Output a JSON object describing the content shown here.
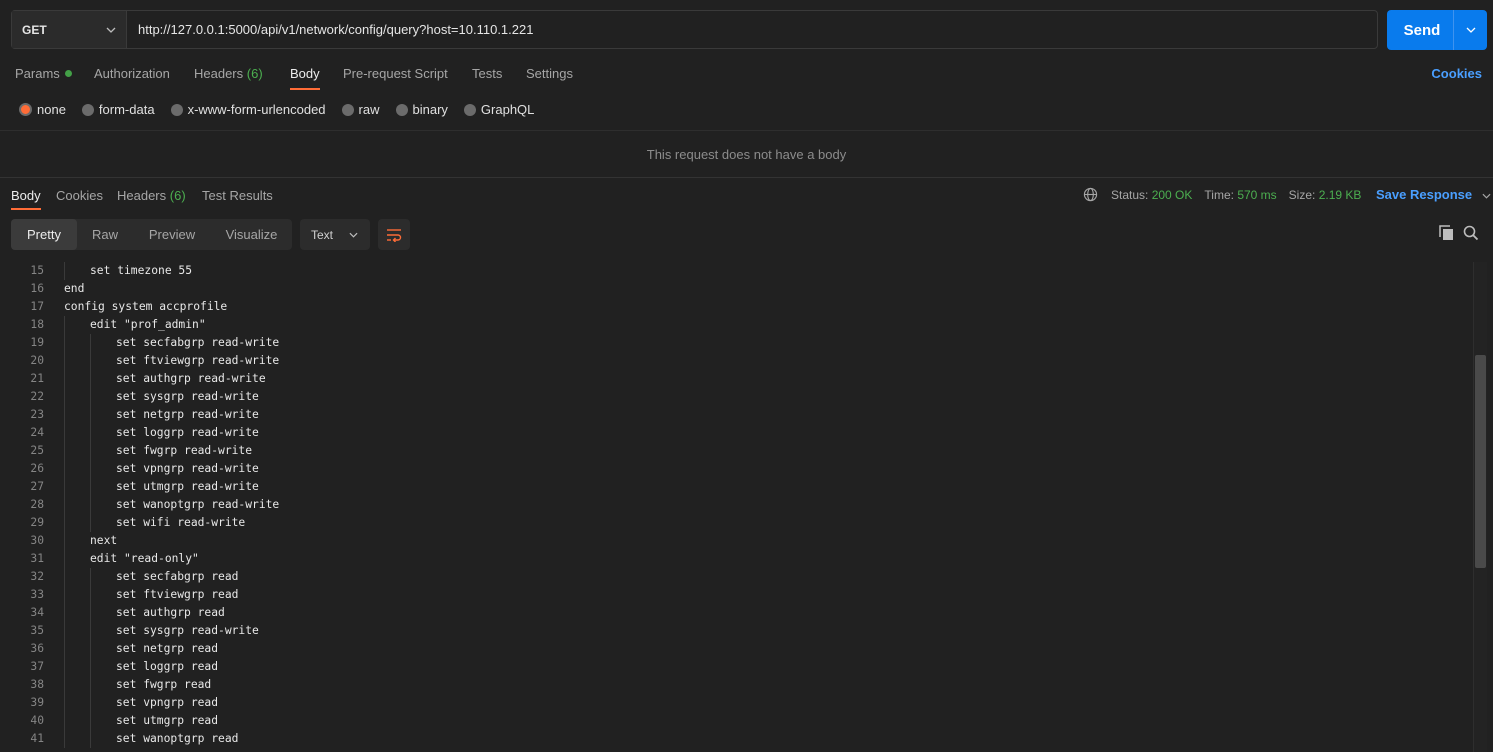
{
  "request": {
    "method": "GET",
    "url": "http://127.0.0.1:5000/api/v1/network/config/query?host=10.110.1.221",
    "send_label": "Send"
  },
  "request_tabs": [
    {
      "label": "Params",
      "count": null,
      "dot": true,
      "active": false
    },
    {
      "label": "Authorization",
      "count": null,
      "active": false
    },
    {
      "label": "Headers",
      "count": "(6)",
      "active": false
    },
    {
      "label": "Body",
      "count": null,
      "active": true
    },
    {
      "label": "Pre-request Script",
      "count": null,
      "active": false
    },
    {
      "label": "Tests",
      "count": null,
      "active": false
    },
    {
      "label": "Settings",
      "count": null,
      "active": false
    }
  ],
  "cookies_link": "Cookies",
  "body_types": [
    {
      "label": "none",
      "checked": true
    },
    {
      "label": "form-data",
      "checked": false
    },
    {
      "label": "x-www-form-urlencoded",
      "checked": false
    },
    {
      "label": "raw",
      "checked": false
    },
    {
      "label": "binary",
      "checked": false
    },
    {
      "label": "GraphQL",
      "checked": false
    }
  ],
  "no_body_message": "This request does not have a body",
  "response_tabs": [
    {
      "label": "Body",
      "count": null,
      "active": true
    },
    {
      "label": "Cookies",
      "count": null,
      "active": false
    },
    {
      "label": "Headers",
      "count": "(6)",
      "active": false
    },
    {
      "label": "Test Results",
      "count": null,
      "active": false
    }
  ],
  "status": {
    "status_label": "Status:",
    "status_value": "200 OK",
    "time_label": "Time:",
    "time_value": "570 ms",
    "size_label": "Size:",
    "size_value": "2.19 KB"
  },
  "save_response": "Save Response",
  "view_modes": [
    "Pretty",
    "Raw",
    "Preview",
    "Visualize"
  ],
  "active_view": "Pretty",
  "format": "Text",
  "colors": {
    "accent": "#ff6c37",
    "primary": "#097bed",
    "success": "#4caf50",
    "link": "#4a9fff"
  },
  "code_lines": [
    {
      "n": "15",
      "text": "set timezone 55",
      "indent": 1
    },
    {
      "n": "16",
      "text": "end",
      "indent": 0
    },
    {
      "n": "17",
      "text": "config system accprofile",
      "indent": 0
    },
    {
      "n": "18",
      "text": "edit \"prof_admin\"",
      "indent": 1
    },
    {
      "n": "19",
      "text": "set secfabgrp read-write",
      "indent": 2
    },
    {
      "n": "20",
      "text": "set ftviewgrp read-write",
      "indent": 2
    },
    {
      "n": "21",
      "text": "set authgrp read-write",
      "indent": 2
    },
    {
      "n": "22",
      "text": "set sysgrp read-write",
      "indent": 2
    },
    {
      "n": "23",
      "text": "set netgrp read-write",
      "indent": 2
    },
    {
      "n": "24",
      "text": "set loggrp read-write",
      "indent": 2
    },
    {
      "n": "25",
      "text": "set fwgrp read-write",
      "indent": 2
    },
    {
      "n": "26",
      "text": "set vpngrp read-write",
      "indent": 2
    },
    {
      "n": "27",
      "text": "set utmgrp read-write",
      "indent": 2
    },
    {
      "n": "28",
      "text": "set wanoptgrp read-write",
      "indent": 2
    },
    {
      "n": "29",
      "text": "set wifi read-write",
      "indent": 2
    },
    {
      "n": "30",
      "text": "next",
      "indent": 1
    },
    {
      "n": "31",
      "text": "edit \"read-only\"",
      "indent": 1
    },
    {
      "n": "32",
      "text": "set secfabgrp read",
      "indent": 2
    },
    {
      "n": "33",
      "text": "set ftviewgrp read",
      "indent": 2
    },
    {
      "n": "34",
      "text": "set authgrp read",
      "indent": 2
    },
    {
      "n": "35",
      "text": "set sysgrp read-write",
      "indent": 2
    },
    {
      "n": "36",
      "text": "set netgrp read",
      "indent": 2
    },
    {
      "n": "37",
      "text": "set loggrp read",
      "indent": 2
    },
    {
      "n": "38",
      "text": "set fwgrp read",
      "indent": 2
    },
    {
      "n": "39",
      "text": "set vpngrp read",
      "indent": 2
    },
    {
      "n": "40",
      "text": "set utmgrp read",
      "indent": 2
    },
    {
      "n": "41",
      "text": "set wanoptgrp read",
      "indent": 2
    }
  ]
}
